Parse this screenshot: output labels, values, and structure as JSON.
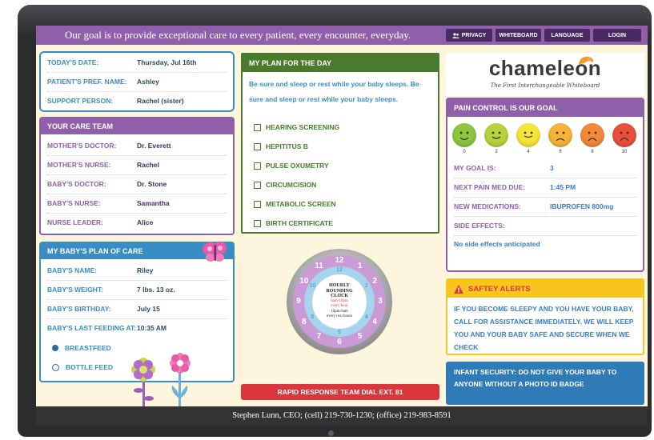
{
  "header": {
    "tagline": "Our goal is to provide exceptional care to every patient, every encounter, everyday.",
    "buttons": [
      "PRIVACY",
      "WHITEBOARD",
      "LANGUAGE",
      "LOGIN"
    ]
  },
  "patient_info": {
    "rows": [
      {
        "label": "TODAY'S DATE:",
        "value": "Thursday, Jul 16th"
      },
      {
        "label": "PATIENT'S PREF. NAME:",
        "value": "Ashley"
      },
      {
        "label": "SUPPORT PERSON:",
        "value": "Rachel (sister)"
      }
    ]
  },
  "care_team": {
    "title": "YOUR CARE TEAM",
    "rows": [
      {
        "label": "MOTHER'S DOCTOR:",
        "value": "Dr. Everett"
      },
      {
        "label": "MOTHER'S NURSE:",
        "value": "Rachel"
      },
      {
        "label": "BABY'S DOCTOR:",
        "value": "Dr. Stone"
      },
      {
        "label": "BABY'S NURSE:",
        "value": "Samantha"
      },
      {
        "label": "NURSE LEADER:",
        "value": "Alice"
      }
    ]
  },
  "baby_plan": {
    "title": "MY BABY'S PLAN OF CARE",
    "rows": [
      {
        "label": "BABY'S NAME:",
        "value": "Riley"
      },
      {
        "label": "BABY'S WEIGHT:",
        "value": "7 lbs. 13 oz."
      },
      {
        "label": "BABY'S BIRTHDAY:",
        "value": "July 15"
      },
      {
        "label": "BABY'S LAST FEEDING AT:",
        "value": "10:35 AM"
      }
    ],
    "options": [
      "BREASTFEED",
      "BOTTLE FEED"
    ]
  },
  "plan_day": {
    "title": "MY PLAN FOR THE DAY",
    "text": "Be sure and sleep or rest while your baby sleeps. Be sure and sleep or rest while your baby sleeps.",
    "checklist": [
      "HEARING SCREENING",
      "HEPITITUS B",
      "PULSE OXUMETRY",
      "CIRCUMCISION",
      "METABOLIC SCREEN",
      "BIRTH CERTIFICATE"
    ]
  },
  "clock": {
    "title_lines": [
      "HOURLY",
      "ROUNDING",
      "CLOCK"
    ],
    "red_lines": [
      "6am-10pm",
      "every hour"
    ],
    "black_lines": [
      "10pm-6am",
      "every two hours"
    ],
    "outer": [
      "12",
      "1",
      "2",
      "3",
      "4",
      "5",
      "6",
      "7",
      "8",
      "9",
      "10",
      "11"
    ],
    "inner": [
      "12",
      "2",
      "4",
      "6",
      "8",
      "10"
    ]
  },
  "rapid_response": "RAPID RESPONSE TEAM DIAL EXT. 81",
  "logo": {
    "name": "chameleon",
    "tagline": "The First Interchangeable Whiteboard"
  },
  "pain": {
    "title": "PAIN CONTROL IS OUR GOAL",
    "scale": [
      "0",
      "2",
      "4",
      "6",
      "8",
      "10"
    ],
    "face_colors": [
      "#8cc63f",
      "#b6d33c",
      "#f7e43a",
      "#f7b23a",
      "#f0893a",
      "#e8503a"
    ],
    "rows": [
      {
        "label": "MY GOAL IS:",
        "value": "3"
      },
      {
        "label": "NEXT PAIN MED DUE:",
        "value": "1:45 PM"
      },
      {
        "label": "NEW MEDICATIONS:",
        "value": "IBUPROFEN 800mg"
      }
    ],
    "side_label": "SIDE EFFECTS:",
    "side_value": "No side effects anticipated"
  },
  "safety": {
    "title": "SAFTEY ALERTS",
    "text": "IF YOU BECOME SLEEPY AND YOU HAVE YOUR BABY, CALL FOR ASSISTANCE IMMEDIATELY. WE WILL KEEP YOU AND YOUR BABY SAFE AND SECURE WHEN WE CHECK"
  },
  "infant_security": "INFANT SECURITY: DO NOT GIVE YOUR BABY TO ANYONE WITHOUT A PHOTO ID BADGE",
  "footer": "Stephen Lunn, CEO; (cell) 219-730-1230; (office) 219-983-8591",
  "colors": {
    "purple": "#8f5fa9",
    "blue": "#3a8dc4",
    "green": "#4a7a2e",
    "red": "#d9363e",
    "yellow": "#f7c51e"
  }
}
